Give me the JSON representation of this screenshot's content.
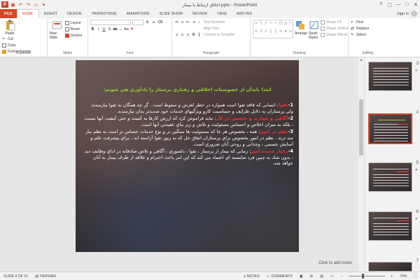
{
  "app": {
    "window_title": "اخلاق ارتباط با بیمار.pptx - PowerPoint",
    "logo": "P",
    "sign_in": "Sign in"
  },
  "window_controls": [
    "?",
    "▢",
    "—",
    "□",
    "✕"
  ],
  "tabs": [
    "FILE",
    "HOME",
    "INSERT",
    "DESIGN",
    "TRANSITIONS",
    "ANIMATIONS",
    "SLIDE SHOW",
    "REVIEW",
    "VIEW",
    "ADD-INS"
  ],
  "active_tab": "HOME",
  "ribbon": {
    "clipboard": {
      "paste": "Paste",
      "cut": "Cut",
      "copy": "Copy",
      "format_painter": "Format Painter",
      "label": "Clipboard"
    },
    "slides": {
      "new_slide": "New Slide",
      "layout": "Layout",
      "reset": "Reset",
      "section": "Section",
      "label": "Slides"
    },
    "font": {
      "label": "Font"
    },
    "paragraph": {
      "text_direction": "Text Direction",
      "align_text": "Align Text",
      "convert_smartart": "Convert to SmartArt",
      "label": "Paragraph"
    },
    "drawing": {
      "arrange": "Arrange",
      "quick_styles": "Quick Styles",
      "shape_fill": "Shape Fill",
      "shape_outline": "Shape Outline",
      "shape_effects": "Shape Effects",
      "label": "Drawing"
    },
    "editing": {
      "find": "Find",
      "replace": "Replace",
      "select": "Select",
      "label": "Editing"
    }
  },
  "slide": {
    "heading": "ابتدا بايدآن از خصوصيات اخلاقي و رفتاري پرستار را يادآوري هي شويم:",
    "items": [
      {
        "num": "1-",
        "label": "تقوا",
        "text": ": انساني كه فاقد تقوا است همواره در خطر لغزش و سقوط است . گر چه همگان به تقوا نيازمندند ولي پرستاران به دلايل ظرايف و حساسيت كارو ويژگيهاي خدمات خود شديدتر بدان نيازمندند."
      },
      {
        "num": "2-",
        "label": "آگاهي و مهارت و تخصص در كار",
        "text": ": نبايد فراموش كرد كه ارزش كارها به كميت و حتي كيفيت آنها نيست ، بلكه به ميزان اخلاص و احساس مسئوليت و تلاش و زير بناي عقيدتي آنها است."
      },
      {
        "num": "3-",
        "label": "نظم در امور",
        "text": ": همه ، بخصوص هر جا كه مسئوليت ها سنگين تر و نوع خدمات حساس تر است به نظم نياز مند ترند . نظم در امور بخصوص براي پرستاران اتفاق حل كه به زيور تقوا آراسته اند ، براي پيشرفت علم و آسايش جسمي ، وجداني و روحي آنان ضروري است."
      },
      {
        "num": "4-",
        "label": "رفتار محبت آميز",
        "text": ": زماني كه بيمار از پرستار ، تقوا ، دلسوزي ، آگاهي و تلاش صادقانه در اداي وظايف ديد ، بدون شك به چنين فرد شايسته اي اعتماد مي كند كه اين امر باعث احترام و علاقه از طرف بيمار به آنان خواهد شد."
      }
    ]
  },
  "notes_placeholder": "Click to add notes",
  "thumbnails": [
    {
      "num": "3",
      "selected": false
    },
    {
      "num": "4",
      "selected": true
    },
    {
      "num": "5",
      "selected": false
    },
    {
      "num": "6",
      "selected": false
    },
    {
      "num": "7",
      "selected": false
    }
  ],
  "status": {
    "slide_of": "SLIDE 4 OF 21",
    "language": "PERSIAN",
    "notes": "NOTES",
    "comments": "COMMENTS",
    "zoom": "70%"
  },
  "zoom_level_percent": 70,
  "colors": {
    "accent": "#d24726",
    "heading": "#9acd32",
    "label_red": "#ff2a2a"
  }
}
